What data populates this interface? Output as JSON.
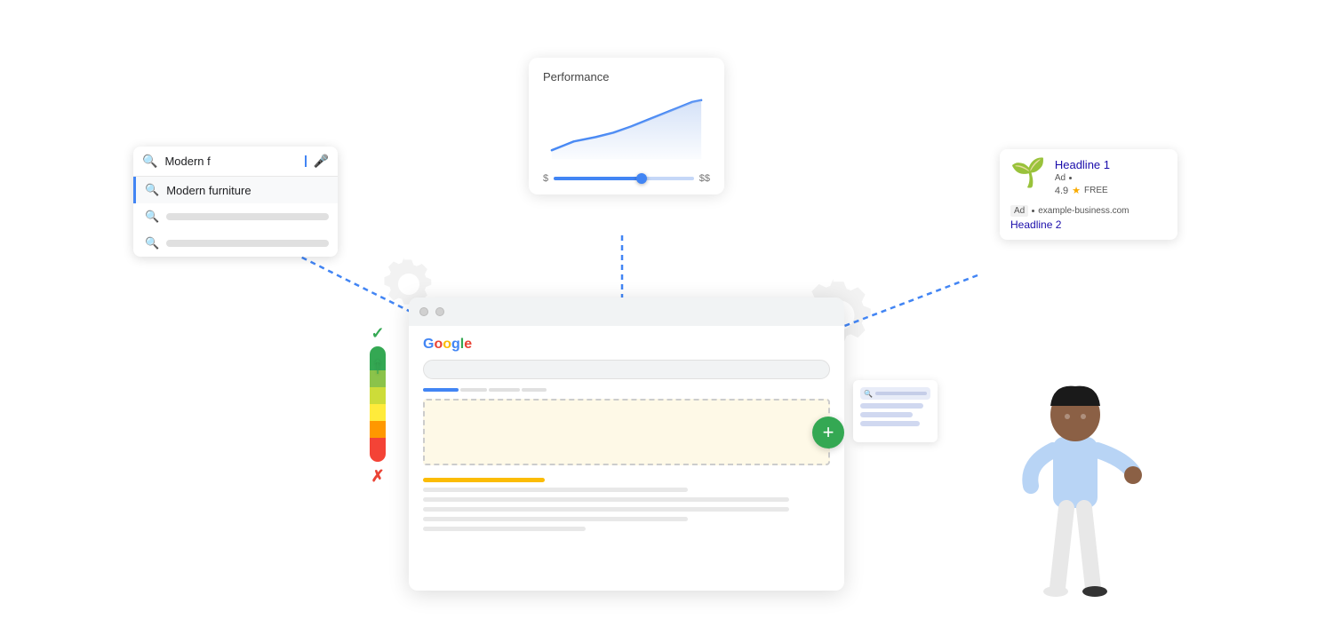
{
  "search": {
    "input_value": "Modern f",
    "suggestions": [
      {
        "text": "Modern furniture",
        "active": true
      },
      {
        "text": "",
        "placeholder": true
      },
      {
        "text": "",
        "placeholder": true
      }
    ]
  },
  "performance_card": {
    "title": "Performance",
    "budget_labels": {
      "low": "$",
      "high": "$$"
    }
  },
  "ad_preview": {
    "headline1": "Headline 1",
    "ad_label": "Ad",
    "rating": "4.9",
    "free_label": "FREE",
    "url": "example-business.com",
    "headline2": "Headline 2"
  },
  "browser": {
    "logo_letters": [
      "G",
      "o",
      "o",
      "g",
      "l",
      "e"
    ],
    "plus_label": "+"
  },
  "icons": {
    "search": "🔍",
    "mic": "🎤",
    "check": "✓",
    "x": "✗",
    "star": "★",
    "plant": "🌱"
  }
}
